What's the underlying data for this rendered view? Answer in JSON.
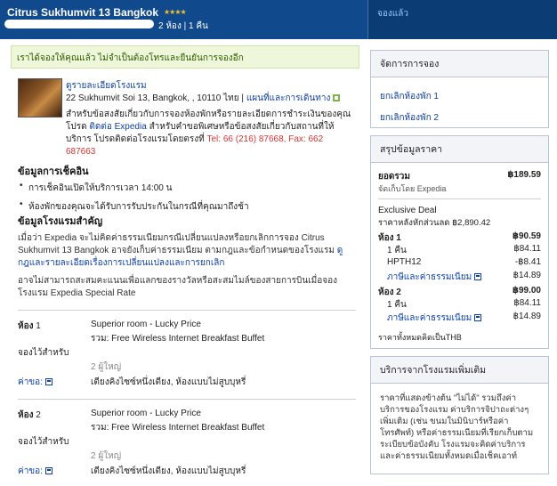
{
  "header": {
    "hotel_name": "Citrus Sukhumvit 13 Bangkok",
    "stars": "★★★★",
    "rooms_nights": "2 ห้อง | 1 คืน",
    "booking_status": "จองแล้ว"
  },
  "confirm_message": "เราได้จองให้คุณแล้ว ไม่จำเป็นต้องโทรและยืนยันการจองอีก",
  "hotel": {
    "details_link": "ดูรายละเอียดโรงแรม",
    "address": "22 Sukhumvit Soi 13, Bangkok, , 10110 ไทย",
    "map_link": "แผนที่และการเดินทาง",
    "note_1": "สำหรับข้อสงสัยเกี่ยวกับการจองห้องพักหรือรายละเอียดการชำระเงินของคุณ โปรด",
    "contact_link": "ติดต่อ Expedia",
    "note_2": "สำหรับคำขอพิเศษหรือข้อสงสัยเกี่ยวกับสถานที่ให้บริการ โปรดติดต่อโรงแรมโดยตรงที่",
    "phone": "Tel: 66 (216) 87668, Fax: 662 687663"
  },
  "checkin": {
    "title": "ข้อมูลการเช็คอิน",
    "items": [
      "การเช็คอินเปิดให้บริการเวลา 14:00 น",
      "ห้องพักของคุณจะได้รับการรับประกันในกรณีที่คุณมาถึงช้า"
    ]
  },
  "important": {
    "title": "ข้อมูลโรงแรมสำคัญ",
    "p1": "เมื่อว่า Expedia จะไม่คิดค่าธรรมเนียมกรณีเปลี่ยนแปลงหรือยกเลิกการจอง Citrus Sukhumvit 13 Bangkok อาจยังเก็บค่าธรรมเนียม ตามกฎและข้อกำหนดของโรงแรม",
    "p1_link": "ดูกฎและรายละเอียดเรื่องการเปลี่ยนแปลงและการยกเลิก",
    "p2": "อาจไม่สามารถสะสมคะแนนเพื่อแลกของรางวัลหรือสะสมไมล์ของสายการบินเมื่อจองโรงแรม Expedia Special Rate"
  },
  "rooms": [
    {
      "label": "ห้อง",
      "number": "1",
      "type": "Superior room - Lucky Price",
      "amenities": "รวม: Free Wireless Internet Breakfast Buffet",
      "reserved_for_label": "จองไว้สำหรับ",
      "guests": "2 ผู้ใหญ่",
      "fees_label": "ค่าขอ:",
      "beds": "เตียงคิงไซซ์หนึ่งเตียง, ห้องแบบไม่สูบบุหรี่"
    },
    {
      "label": "ห้อง",
      "number": "2",
      "type": "Superior room - Lucky Price",
      "amenities": "รวม: Free Wireless Internet Breakfast Buffet",
      "reserved_for_label": "จองไว้สำหรับ",
      "guests": "2 ผู้ใหญ่",
      "fees_label": "ค่าขอ:",
      "beds": "เตียงคิงไซซ์หนึ่งเตียง, ห้องแบบไม่สูบบุหรี่"
    }
  ],
  "manage": {
    "title": "จัดการการจอง",
    "items": [
      "ยกเลิกห้องพัก 1",
      "ยกเลิกห้องพัก 2"
    ]
  },
  "price": {
    "title": "สรุปข้อมูลราคา",
    "total_label": "ยอดรวม",
    "total_value": "฿189.59",
    "processed_by": "จัดเก็บโดย Expedia",
    "deal_label": "Exclusive Deal",
    "deal_note": "ราคาหลังหักส่วนลด ฿2,890.42",
    "room1_label": "ห้อง 1",
    "room1_value": "฿90.59",
    "room1_night_label": "1 คืน",
    "room1_night_value": "฿84.11",
    "promo_label": "HPTH12",
    "promo_value": "-฿8.41",
    "tax1_label": "ภาษีและค่าธรรมเนียม",
    "tax1_value": "฿14.89",
    "room2_label": "ห้อง 2",
    "room2_value": "฿99.00",
    "room2_night_label": "1 คืน",
    "room2_night_value": "฿84.11",
    "tax2_label": "ภาษีและค่าธรรมเนียม",
    "tax2_value": "฿14.89",
    "currency_note": "ราคาทั้งหมดคิดเป็นTHB"
  },
  "extras": {
    "title": "บริการจากโรงแรมเพิ่มเติม",
    "text": "ราคาที่แสดงข้างต้น \"ไม่ได้\" รวมถึงค่าบริการของโรงแรม ค่าบริการจิปาถะต่างๆ เพิ่มเติม (เช่น ขนมในมินิบาร์หรือค่าโทรศัพท์) หรือค่าธรรมเนียมที่เรียกเก็บตามระเบียบข้อบังคับ โรงแรมจะคิดค่าบริการและค่าธรรมเนียมทั้งหมดเมื่อเช็คเอาท์"
  }
}
